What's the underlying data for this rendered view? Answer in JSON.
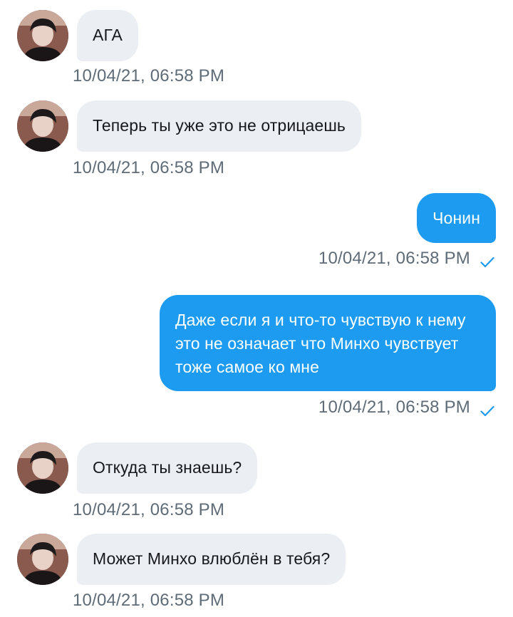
{
  "conversation": {
    "messages": [
      {
        "direction": "incoming",
        "text": "АГА",
        "timestamp": "10/04/21, 06:58 PM"
      },
      {
        "direction": "incoming",
        "text": "Теперь ты уже это не отрицаешь",
        "timestamp": "10/04/21, 06:58 PM"
      },
      {
        "direction": "outgoing",
        "text": "Чонин",
        "timestamp": "10/04/21, 06:58 PM",
        "status_icon": "checkmark-icon"
      },
      {
        "direction": "outgoing",
        "text": "Даже если я и что-то чувствую к нему это не означает что Минхо чувствует тоже самое ко мне",
        "timestamp": "10/04/21, 06:58 PM",
        "status_icon": "checkmark-icon"
      },
      {
        "direction": "incoming",
        "text": "Откуда ты знаешь?",
        "timestamp": "10/04/21, 06:58 PM"
      },
      {
        "direction": "incoming",
        "text": "Может Минхо влюблён в тебя?",
        "timestamp": "10/04/21, 06:58 PM"
      }
    ]
  },
  "colors": {
    "incoming_bubble": "#ebeef2",
    "outgoing_bubble": "#1d9bf0",
    "timestamp_text": "#5f6b76",
    "checkmark": "#1d9bf0"
  }
}
